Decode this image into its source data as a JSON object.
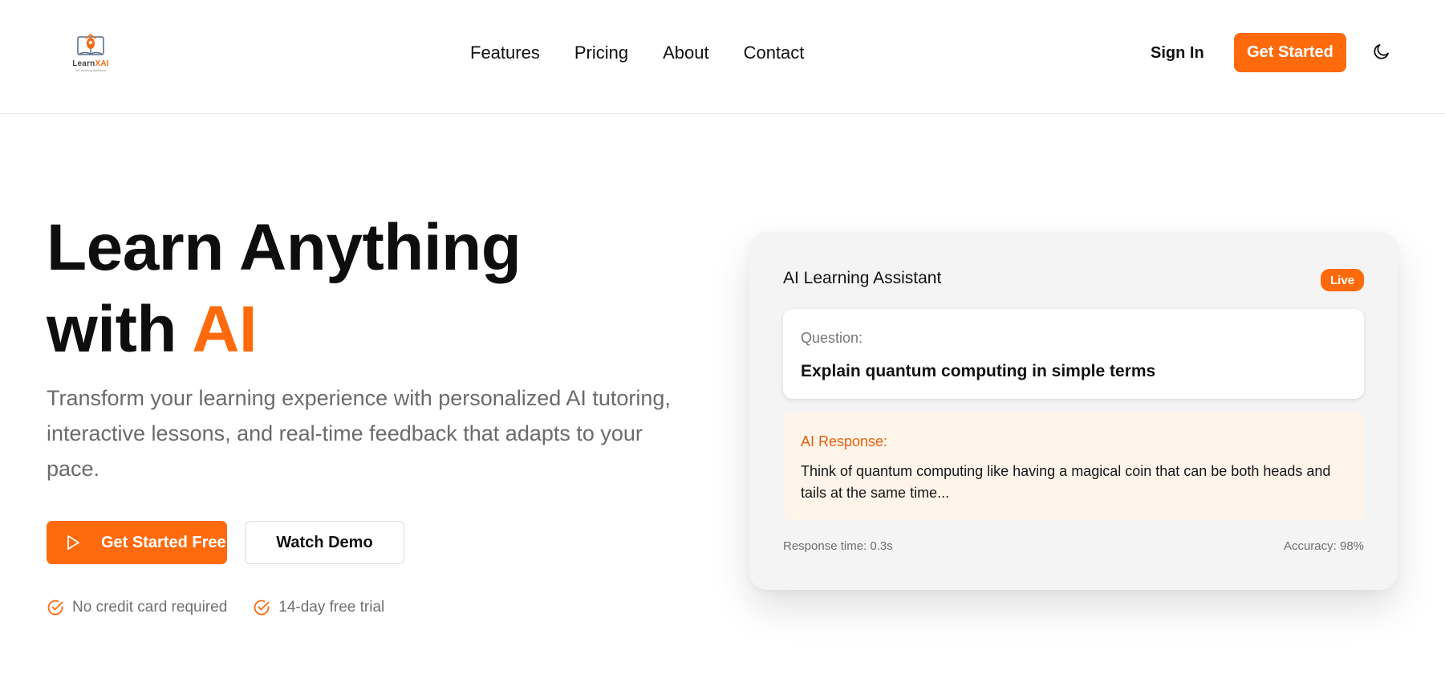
{
  "brand": {
    "logo_text_main": "Learn",
    "logo_text_accent": "XAI",
    "logo_tagline": "AI Learning Assistant",
    "accent_color": "#ff6a0d"
  },
  "nav": {
    "links": [
      "Features",
      "Pricing",
      "About",
      "Contact"
    ]
  },
  "header": {
    "sign_in": "Sign In",
    "get_started": "Get Started",
    "theme_icon": "moon-icon"
  },
  "hero": {
    "title_line1": "Learn Anything",
    "title_line2_prefix": "with ",
    "title_line2_accent": "AI",
    "subtitle": "Transform your learning experience with personalized AI tutoring, interactive lessons, and real-time feedback that adapts to your pace.",
    "primary_cta": "Get Started Free",
    "primary_cta_icon": "play-icon",
    "secondary_cta": "Watch Demo",
    "perks": [
      "No credit card required",
      "14-day free trial"
    ],
    "perk_icon": "check-circle-icon"
  },
  "assistant_card": {
    "title": "AI Learning Assistant",
    "badge": "Live",
    "question_label": "Question:",
    "question_text": "Explain quantum computing in simple terms",
    "response_label": "AI Response:",
    "response_text": "Think of quantum computing like having a magical coin that can be both heads and tails at the same time...",
    "response_time": "Response time: 0.3s",
    "accuracy": "Accuracy: 98%"
  }
}
